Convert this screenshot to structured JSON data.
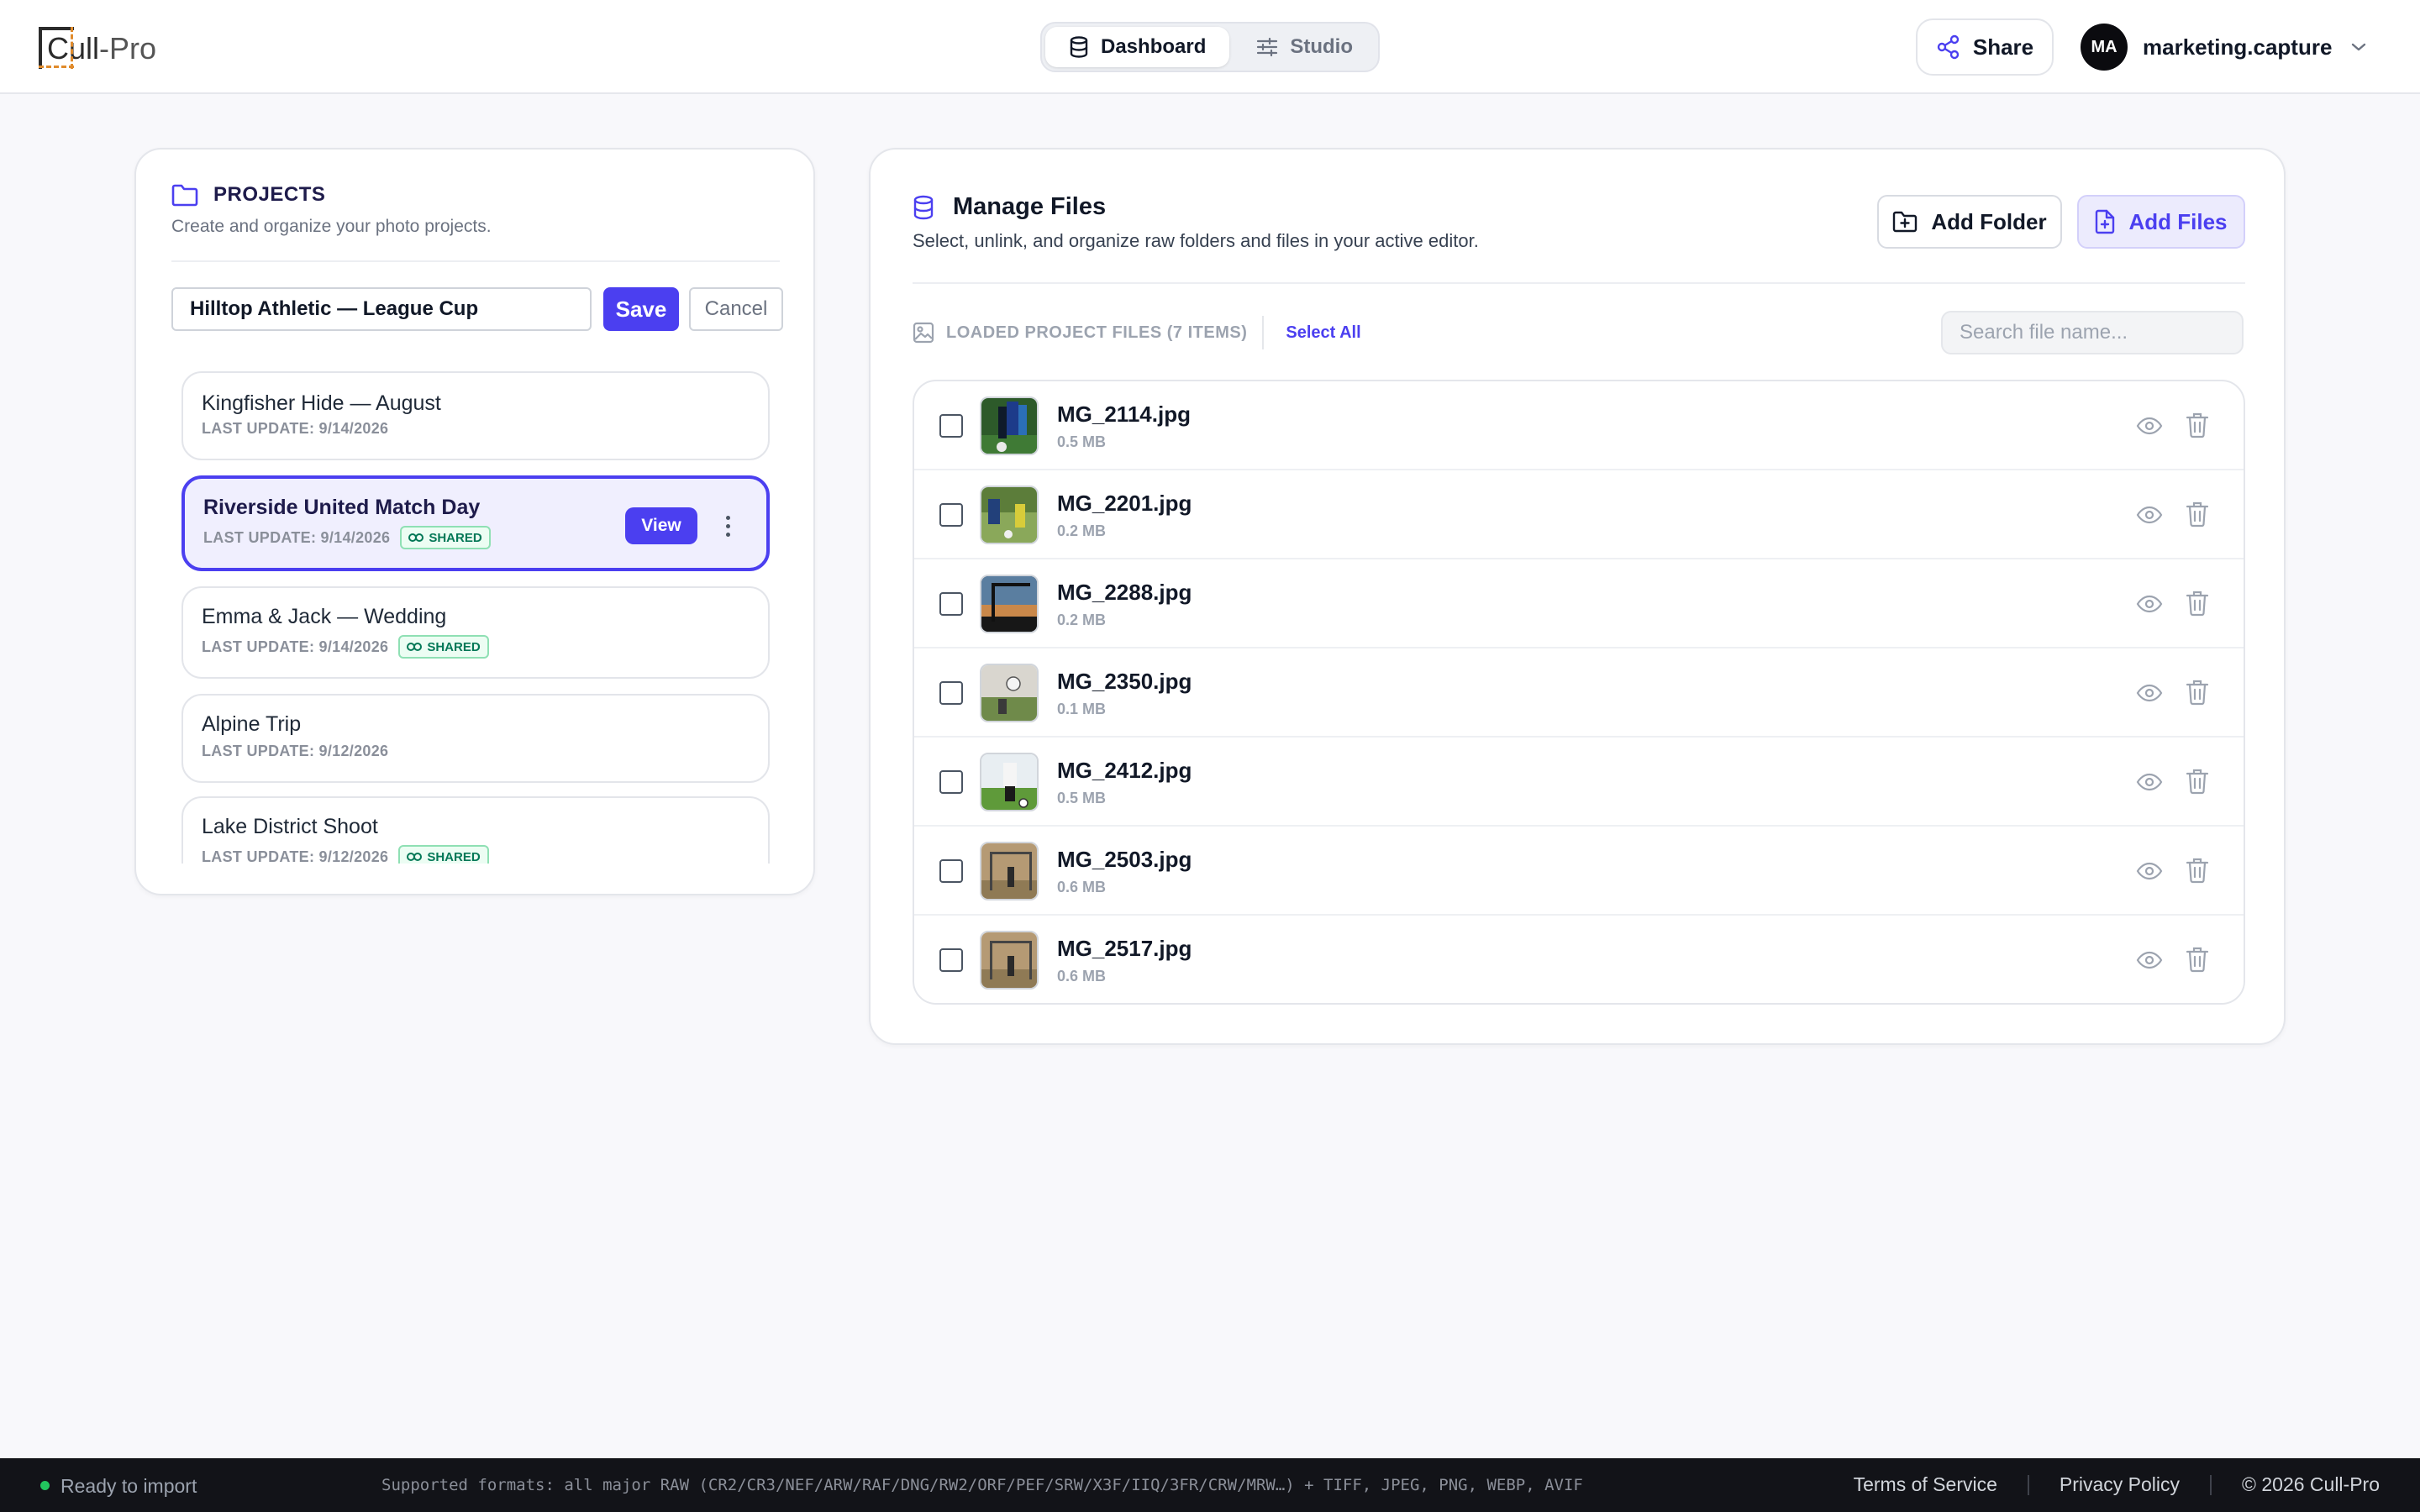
{
  "header": {
    "logo": {
      "part_a": "Cull",
      "part_b": "-Pro"
    },
    "tabs": [
      {
        "label": "Dashboard",
        "icon": "database-icon",
        "active": true
      },
      {
        "label": "Studio",
        "icon": "sliders-icon",
        "active": false
      }
    ],
    "share_label": "Share",
    "user": {
      "initials": "MA",
      "name": "marketing.capture"
    }
  },
  "projects": {
    "title": "PROJECTS",
    "subtitle": "Create and organize your photo projects.",
    "edit_value": "Hilltop Athletic — League Cup",
    "save_label": "Save",
    "cancel_label": "Cancel",
    "view_label": "View",
    "shared_label": "SHARED",
    "items": [
      {
        "name": "Kingfisher Hide — August",
        "date": "LAST UPDATE: 9/14/2026",
        "shared": false,
        "selected": false
      },
      {
        "name": "Riverside United Match Day",
        "date": "LAST UPDATE: 9/14/2026",
        "shared": true,
        "selected": true
      },
      {
        "name": "Emma & Jack — Wedding",
        "date": "LAST UPDATE: 9/14/2026",
        "shared": true,
        "selected": false
      },
      {
        "name": "Alpine Trip",
        "date": "LAST UPDATE: 9/12/2026",
        "shared": false,
        "selected": false
      },
      {
        "name": "Lake District Shoot",
        "date": "LAST UPDATE: 9/12/2026",
        "shared": true,
        "selected": false
      }
    ]
  },
  "files": {
    "title": "Manage Files",
    "subtitle": "Select, unlink, and organize raw folders and files in your active editor.",
    "add_folder_label": "Add Folder",
    "add_files_label": "Add Files",
    "loaded_label": "LOADED PROJECT FILES (7 ITEMS)",
    "select_all_label": "Select All",
    "search_placeholder": "Search file name...",
    "rows": [
      {
        "name": "MG_2114.jpg",
        "size": "0.5 MB"
      },
      {
        "name": "MG_2201.jpg",
        "size": "0.2 MB"
      },
      {
        "name": "MG_2288.jpg",
        "size": "0.2 MB"
      },
      {
        "name": "MG_2350.jpg",
        "size": "0.1 MB"
      },
      {
        "name": "MG_2412.jpg",
        "size": "0.5 MB"
      },
      {
        "name": "MG_2503.jpg",
        "size": "0.6 MB"
      },
      {
        "name": "MG_2517.jpg",
        "size": "0.6 MB"
      }
    ]
  },
  "footer": {
    "status": "Ready to import",
    "formats": "Supported formats: all major RAW (CR2/CR3/NEF/ARW/RAF/DNG/RW2/ORF/PEF/SRW/X3F/IIQ/3FR/CRW/MRW…) + TIFF, JPEG, PNG, WEBP, AVIF",
    "terms": "Terms of Service",
    "privacy": "Privacy Policy",
    "copyright": "© 2026 Cull-Pro"
  },
  "colors": {
    "accent": "#4b3ff0",
    "shared_green": "#047857",
    "status_green": "#22c55e",
    "footer_bg": "#121318"
  }
}
